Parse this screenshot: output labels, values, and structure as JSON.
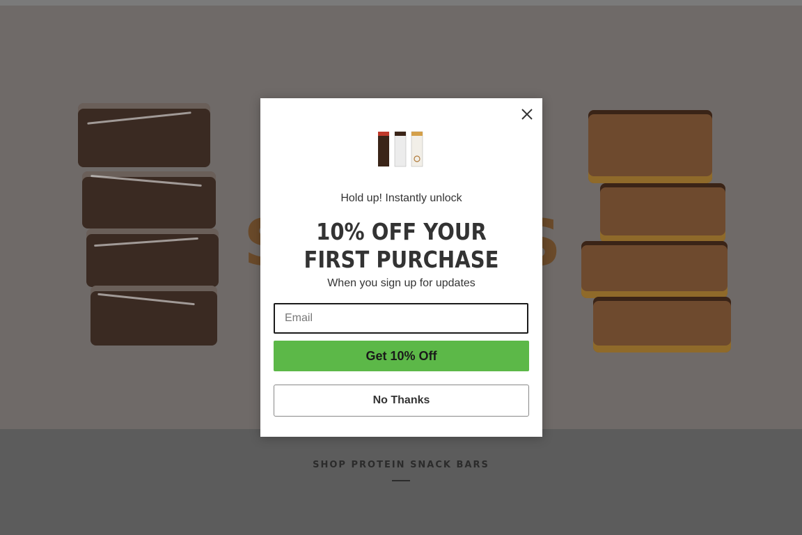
{
  "hero": {
    "background_color": "#6f6a68",
    "partial_word_left": "S",
    "partial_word_right": "S"
  },
  "modal": {
    "logo_icon": "protein-bar-packages-logo",
    "pre_title": "Hold up! Instantly unlock",
    "headline": "10% OFF YOUR FIRST PURCHASE",
    "sub_title": "When you sign up for updates",
    "email_placeholder": "Email",
    "submit_label": "Get 10% Off",
    "decline_label": "No Thanks",
    "close_icon": "close-icon",
    "accent_color": "#5cb848"
  },
  "section": {
    "title": "SHOP PROTEIN SNACK BARS"
  }
}
